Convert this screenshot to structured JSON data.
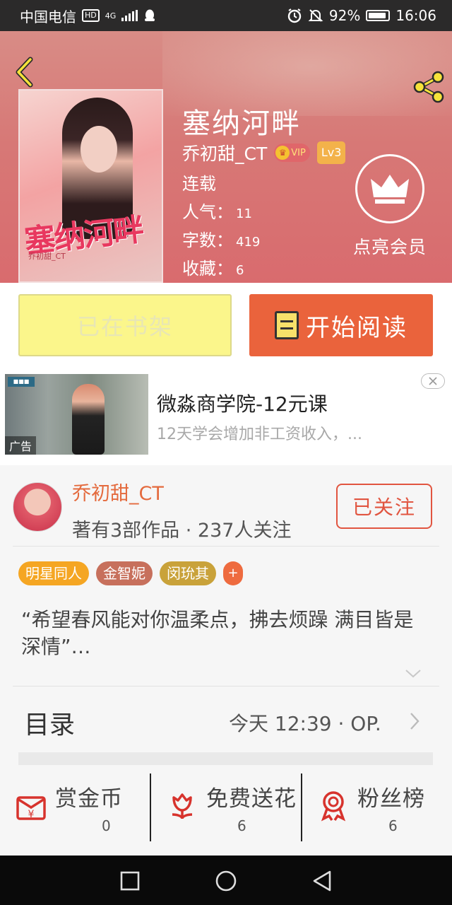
{
  "status_bar": {
    "carrier": "中国电信",
    "hd": "HD",
    "network": "4G",
    "battery": "92%",
    "time": "16:06"
  },
  "book": {
    "title": "塞纳河畔",
    "author": "乔初甜_CT",
    "vip_label": "VIP",
    "level": "Lv3",
    "status": "连载",
    "popularity_label": "人气：",
    "popularity": "11",
    "word_count_label": "字数：",
    "word_count": "419",
    "favorites_label": "收藏：",
    "favorites": "6",
    "member_label": "点亮会员",
    "cover_title": "塞纳河畔"
  },
  "actions": {
    "on_shelf": "已在书架",
    "start_reading": "开始阅读"
  },
  "ad": {
    "title": "微淼商学院-12元课",
    "subtitle": "12天学会增加非工资收入，...",
    "tag": "广告"
  },
  "author_card": {
    "name": "乔初甜_CT",
    "works_summary": "著有3部作品 · 237人关注",
    "follow_label": "已关注",
    "tags": [
      {
        "label": "明星同人",
        "color": "#f5a623"
      },
      {
        "label": "金智妮",
        "color": "#c7705c"
      },
      {
        "label": "闵玧其",
        "color": "#c9a23a"
      }
    ],
    "tag_more": "+",
    "quote": "“希望春风能对你温柔点，拂去烦躁 满目皆是深情”…"
  },
  "toc": {
    "label": "目录",
    "latest": "今天 12:39 · OP."
  },
  "bottom_actions": [
    {
      "label": "赏金币",
      "count": "0",
      "icon": "red-envelope-icon"
    },
    {
      "label": "免费送花",
      "count": "6",
      "icon": "flower-icon"
    },
    {
      "label": "粉丝榜",
      "count": "6",
      "icon": "medal-icon"
    }
  ],
  "colors": {
    "accent": "#ea633c",
    "shelf_button": "#fbf68b",
    "hero": "#d77876"
  }
}
